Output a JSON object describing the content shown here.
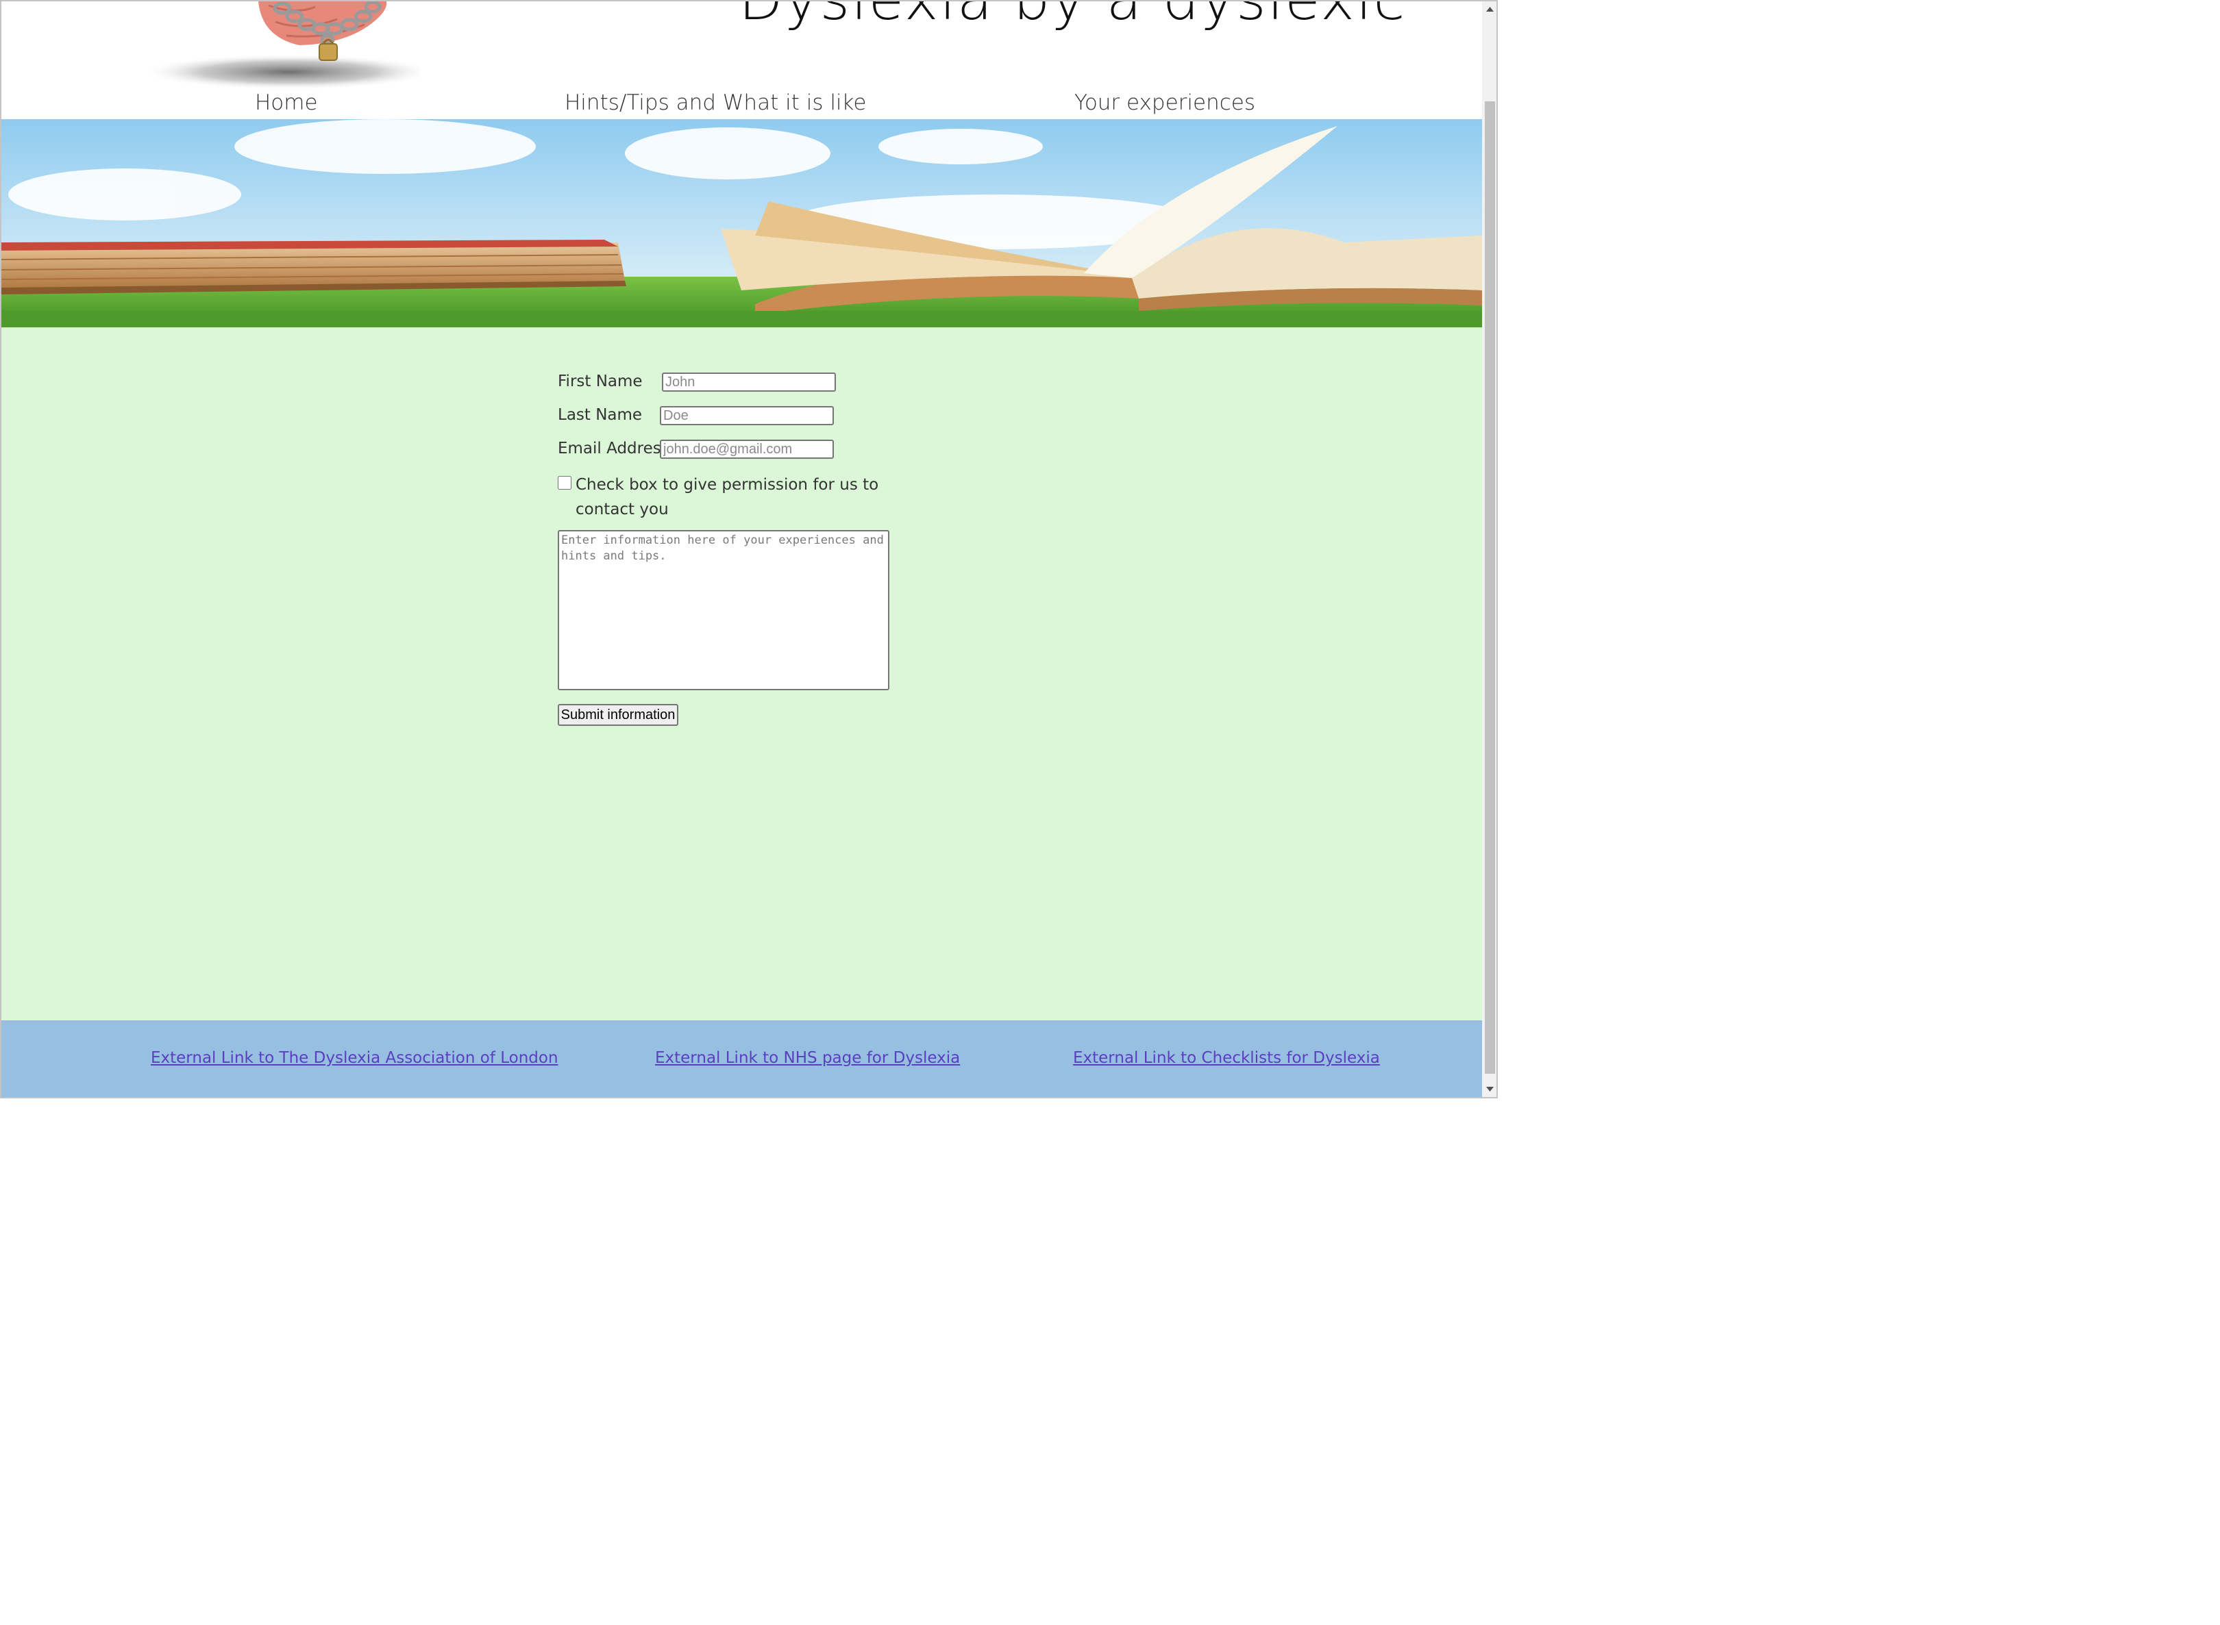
{
  "header": {
    "site_title": "Dyslexia by a dyslexic"
  },
  "nav": {
    "items": [
      {
        "label": "Home"
      },
      {
        "label": "Hints/Tips and What it is like"
      },
      {
        "label": "Your experiences"
      }
    ]
  },
  "form": {
    "first_name_label": "First Name",
    "first_name_placeholder": "John",
    "last_name_label": "Last Name",
    "last_name_placeholder": "Doe",
    "email_label": "Email Address",
    "email_placeholder": "john.doe@gmail.com",
    "consent_label": "Check box to give permission for us to contact you",
    "consent_checked": false,
    "experience_placeholder": "Enter information here of your experiences and hints and tips.",
    "submit_label": "Submit information"
  },
  "footer": {
    "links": [
      {
        "label": "External Link to The Dyslexia Association of London"
      },
      {
        "label": "External Link to NHS page for Dyslexia"
      },
      {
        "label": "External Link to Checklists for Dyslexia"
      }
    ]
  },
  "colors": {
    "form_background": "#dcf7d8",
    "footer_background": "#96bfe2",
    "link_color": "#5a3fc0"
  }
}
